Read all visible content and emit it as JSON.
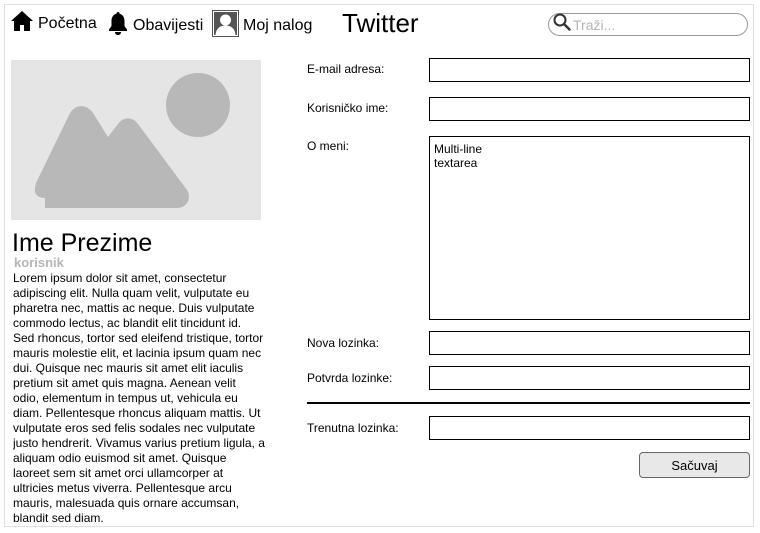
{
  "nav": {
    "home_label": "Početna",
    "notifications_label": "Obavijesti",
    "account_label": "Moj nalog"
  },
  "brand": "Twitter",
  "search": {
    "placeholder": "Traži..."
  },
  "profile": {
    "name": "Ime Prezime",
    "role": "korisnik",
    "bio": "Lorem ipsum dolor sit amet, consectetur adipiscing elit. Nulla quam velit, vulputate eu pharetra nec, mattis ac neque. Duis vulputate commodo lectus, ac blandit elit tincidunt id. Sed rhoncus, tortor sed eleifend tristique, tortor mauris molestie elit, et lacinia ipsum quam nec dui. Quisque nec mauris sit amet elit iaculis pretium sit amet quis magna. Aenean velit odio, elementum in tempus ut, vehicula eu diam. Pellentesque rhoncus aliquam mattis. Ut vulputate eros sed felis sodales nec vulputate justo hendrerit. Vivamus varius pretium ligula, a aliquam odio euismod sit amet. Quisque laoreet sem sit amet orci ullamcorper at ultricies metus viverra. Pellentesque arcu mauris, malesuada quis ornare accumsan, blandit sed diam."
  },
  "form": {
    "email_label": "E-mail adresa:",
    "email_value": "",
    "username_label": "Korisničko ime:",
    "username_value": "",
    "about_label": "O meni:",
    "about_value": "Multi-line\ntextarea",
    "new_password_label": "Nova lozinka:",
    "new_password_value": "",
    "confirm_password_label": "Potvrda lozinke:",
    "confirm_password_value": "",
    "current_password_label": "Trenutna lozinka:",
    "current_password_value": "",
    "save_label": "Sačuvaj"
  },
  "colors": {
    "placeholder_bg": "#e5e5e5",
    "placeholder_shape": "#b8b8b8",
    "muted_text": "#b5b5b5",
    "button_bg": "#e8e8e8"
  },
  "icons": {
    "home": "home-icon",
    "notifications": "bell-icon",
    "account": "user-icon",
    "search": "search-icon",
    "image_placeholder": "image-placeholder-icon"
  }
}
